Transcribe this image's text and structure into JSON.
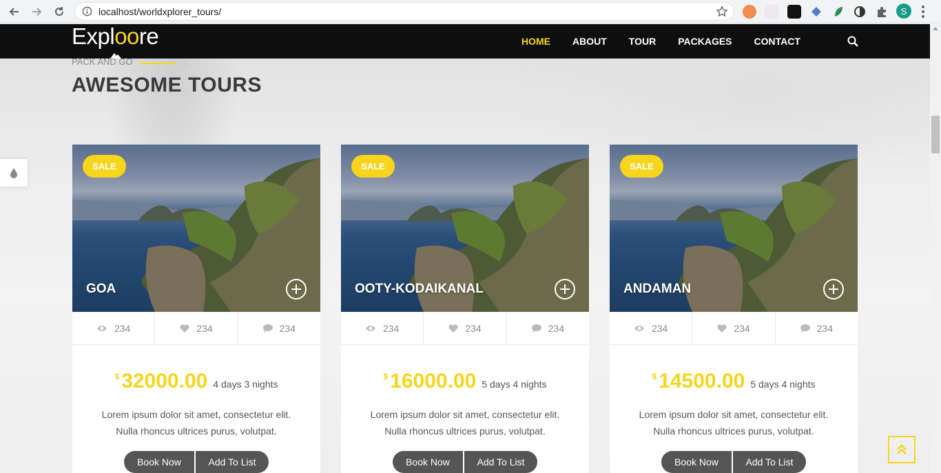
{
  "browser": {
    "url": "localhost/worldxplorer_tours/",
    "profile_initial": "S"
  },
  "site": {
    "logo_left": "Expl",
    "logo_oo": "oo",
    "logo_right": "re",
    "nav": [
      {
        "label": "HOME",
        "active": true
      },
      {
        "label": "ABOUT",
        "active": false
      },
      {
        "label": "TOUR",
        "active": false
      },
      {
        "label": "PACKAGES",
        "active": false
      },
      {
        "label": "CONTACT",
        "active": false
      }
    ],
    "accent_color": "#f7d51d"
  },
  "section": {
    "eyebrow": "PACK AND GO",
    "title": "AWESOME TOURS"
  },
  "tours": [
    {
      "badge": "SALE",
      "name": "GOA",
      "views": "234",
      "likes": "234",
      "comments": "234",
      "currency": "$",
      "price": "32000.00",
      "duration": "4 days 3 nights",
      "desc_line1": "Lorem ipsum dolor sit amet, consectetur elit.",
      "desc_line2": "Nulla rhoncus ultrices purus, volutpat.",
      "book_label": "Book Now",
      "list_label": "Add To List"
    },
    {
      "badge": "SALE",
      "name": "OOTY-KODAIKANAL",
      "views": "234",
      "likes": "234",
      "comments": "234",
      "currency": "$",
      "price": "16000.00",
      "duration": "5 days 4 nights",
      "desc_line1": "Lorem ipsum dolor sit amet, consectetur elit.",
      "desc_line2": "Nulla rhoncus ultrices purus, volutpat.",
      "book_label": "Book Now",
      "list_label": "Add To List"
    },
    {
      "badge": "SALE",
      "name": "ANDAMAN",
      "views": "234",
      "likes": "234",
      "comments": "234",
      "currency": "$",
      "price": "14500.00",
      "duration": "5 days 4 nights",
      "desc_line1": "Lorem ipsum dolor sit amet, consectetur elit.",
      "desc_line2": "Nulla rhoncus ultrices purus, volutpat.",
      "book_label": "Book Now",
      "list_label": "Add To List"
    }
  ]
}
